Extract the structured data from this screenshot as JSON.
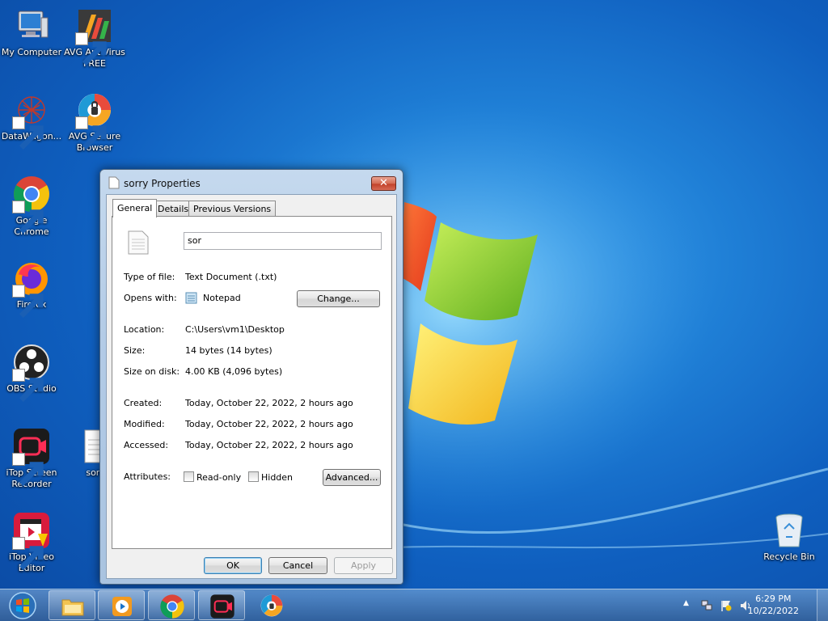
{
  "desktop": {
    "icons": [
      {
        "label": "My Computer"
      },
      {
        "label": "AVG AntiVirus FREE"
      },
      {
        "label": "DataWagon..."
      },
      {
        "label": "AVG Secure Browser"
      },
      {
        "label": "Google Chrome"
      },
      {
        "label": "Firefox"
      },
      {
        "label": "OBS Studio"
      },
      {
        "label": "iTop Screen Recorder"
      },
      {
        "label": "sorr"
      },
      {
        "label": "iTop Video Editor"
      },
      {
        "label": "Recycle Bin"
      }
    ]
  },
  "dialog": {
    "title": "sorry Properties",
    "close_label": "✕",
    "tabs": [
      {
        "label": "General"
      },
      {
        "label": "Details"
      },
      {
        "label": "Previous Versions"
      }
    ],
    "name_value": "sor",
    "type_label": "Type of file:",
    "type_value": "Text Document (.txt)",
    "opens_label": "Opens with:",
    "opens_value": "Notepad",
    "change_button": "Change...",
    "location_label": "Location:",
    "location_value": "C:\\Users\\vm1\\Desktop",
    "size_label": "Size:",
    "size_value": "14 bytes (14 bytes)",
    "size_disk_label": "Size on disk:",
    "size_disk_value": "4.00 KB (4,096 bytes)",
    "created_label": "Created:",
    "created_value": "Today, October 22, 2022, 2 hours ago",
    "modified_label": "Modified:",
    "modified_value": "Today, October 22, 2022, 2 hours ago",
    "accessed_label": "Accessed:",
    "accessed_value": "Today, October 22, 2022, 2 hours ago",
    "attributes_label": "Attributes:",
    "readonly_label": "Read-only",
    "readonly_checked": false,
    "hidden_label": "Hidden",
    "hidden_checked": false,
    "advanced_button": "Advanced...",
    "ok_button": "OK",
    "cancel_button": "Cancel",
    "apply_button": "Apply"
  },
  "taskbar": {
    "time": "6:29 PM",
    "date": "10/22/2022",
    "tray_arrow": "▲"
  }
}
